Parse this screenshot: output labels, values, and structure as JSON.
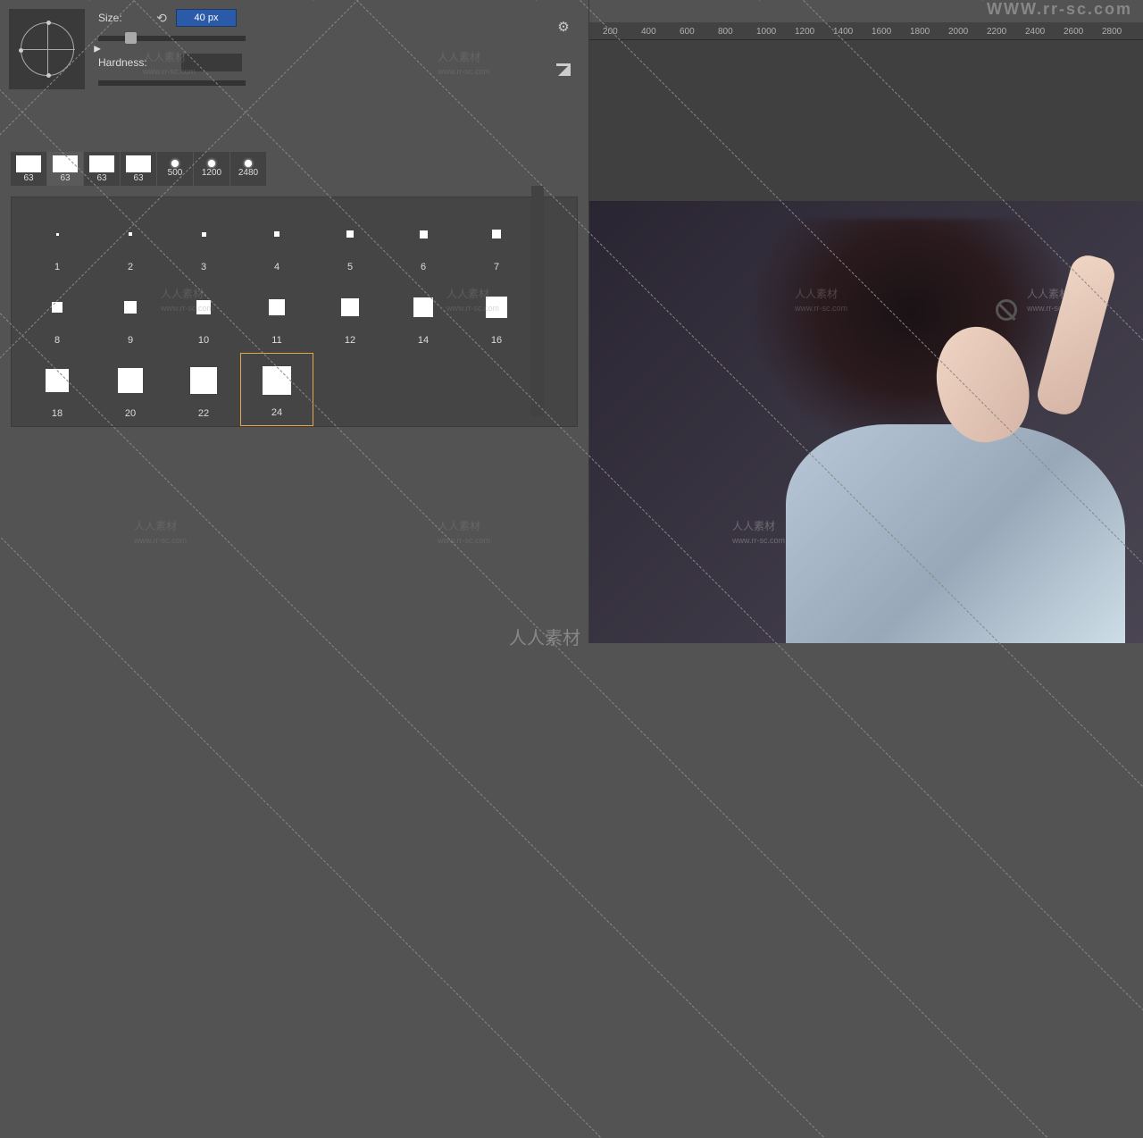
{
  "watermark": {
    "url": "WWW.rr-sc.com",
    "text": "人人素材",
    "sub": "www.rr-sc.com"
  },
  "ruler": {
    "marks": [
      "200",
      "400",
      "600",
      "800",
      "1000",
      "1200",
      "1400",
      "1600",
      "1800",
      "2000",
      "2200",
      "2400",
      "2600",
      "2800"
    ]
  },
  "brush": {
    "size_label": "Size:",
    "size_value": "40 px",
    "hardness_label": "Hardness:",
    "hardness_value": ""
  },
  "recent": [
    {
      "label": "63",
      "type": "square"
    },
    {
      "label": "63",
      "type": "square"
    },
    {
      "label": "63",
      "type": "square"
    },
    {
      "label": "63",
      "type": "square"
    },
    {
      "label": "500",
      "type": "sparkle"
    },
    {
      "label": "1200",
      "type": "sparkle"
    },
    {
      "label": "2480",
      "type": "sparkle"
    }
  ],
  "brushes": [
    {
      "label": "1"
    },
    {
      "label": "2"
    },
    {
      "label": "3"
    },
    {
      "label": "4"
    },
    {
      "label": "5"
    },
    {
      "label": "6"
    },
    {
      "label": "7"
    },
    {
      "label": "8"
    },
    {
      "label": "9"
    },
    {
      "label": "10"
    },
    {
      "label": "11"
    },
    {
      "label": "12"
    },
    {
      "label": "14"
    },
    {
      "label": "16"
    },
    {
      "label": "18"
    },
    {
      "label": "20"
    },
    {
      "label": "22"
    },
    {
      "label": "24",
      "selected": true
    }
  ],
  "icons": {
    "gear": "⚙",
    "reset": "⟲",
    "flyout": "◣"
  }
}
